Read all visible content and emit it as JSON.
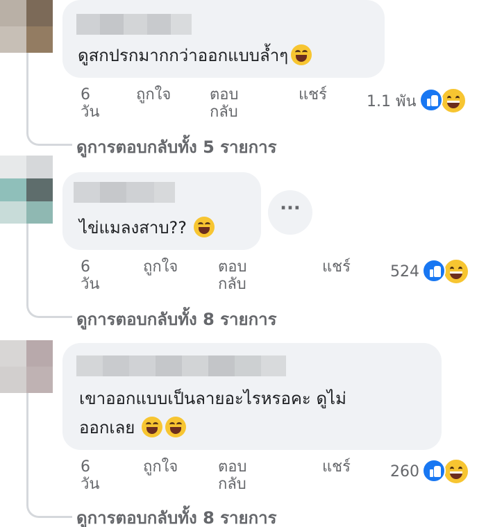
{
  "comments": [
    {
      "text": "ดูสกปรกมากกว่าออกแบบล้ำๆ",
      "emojis": [
        "rolling-on-floor-laughing-icon"
      ],
      "age_number": "6",
      "age_unit": "วัน",
      "like_label": "ถูกใจ",
      "reply_line1": "ตอบ",
      "reply_line2": "กลับ",
      "share_label": "แชร์",
      "reaction_count": "1.1 พัน",
      "reaction_icons": [
        "like-icon",
        "haha-icon"
      ],
      "view_replies": "ดูการตอบกลับทั้ง 5 รายการ"
    },
    {
      "text": "ไข่แมลงสาบ??",
      "emojis": [
        "grinning-squinting-icon"
      ],
      "age_number": "6",
      "age_unit": "วัน",
      "like_label": "ถูกใจ",
      "reply_line1": "ตอบ",
      "reply_line2": "กลับ",
      "share_label": "แชร์",
      "reaction_count": "524",
      "reaction_icons": [
        "like-icon",
        "haha-icon"
      ],
      "more_label": "···",
      "view_replies": "ดูการตอบกลับทั้ง 8 รายการ"
    },
    {
      "text_line1": "เขาออกแบบเป็นลายอะไรหรอคะ ดูไม่",
      "text_line2": "ออกเลย",
      "emojis": [
        "rolling-on-floor-laughing-icon",
        "rolling-on-floor-laughing-icon"
      ],
      "age_number": "6",
      "age_unit": "วัน",
      "like_label": "ถูกใจ",
      "reply_line1": "ตอบ",
      "reply_line2": "กลับ",
      "share_label": "แชร์",
      "reaction_count": "260",
      "reaction_icons": [
        "like-icon",
        "haha-icon"
      ],
      "view_replies": "ดูการตอบกลับทั้ง 8 รายการ"
    }
  ],
  "colors": {
    "bubble": "#f0f2f5",
    "secondary_text": "#65676b",
    "like_blue": "#1877f2",
    "haha_yellow": "#f7c531"
  }
}
